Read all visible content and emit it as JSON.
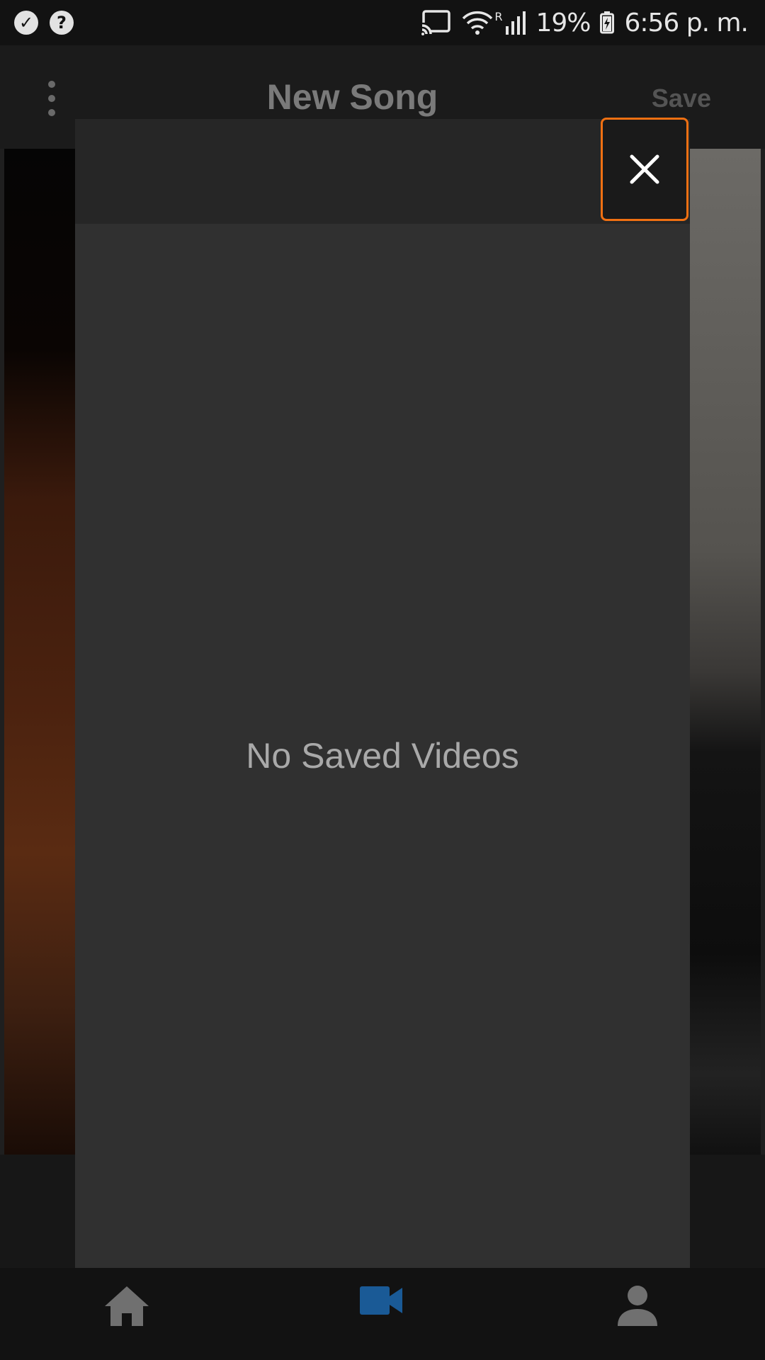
{
  "status_bar": {
    "battery": "19%",
    "time": "6:56 p. m.",
    "roaming": "R",
    "icons": [
      "check-circle-icon",
      "help-circle-icon",
      "cast-icon",
      "wifi-icon",
      "signal-icon",
      "battery-charging-icon"
    ]
  },
  "app_bar": {
    "title": "New Song",
    "save_label": "Save",
    "menu_icon": "more-vertical-icon"
  },
  "modal": {
    "empty_message": "No Saved Videos",
    "close_icon": "close-icon",
    "accent_color": "#f07012"
  },
  "bottom_nav": {
    "items": [
      {
        "name": "home",
        "icon": "home-icon"
      },
      {
        "name": "video",
        "icon": "video-camera-icon",
        "active": true
      },
      {
        "name": "profile",
        "icon": "person-icon"
      }
    ],
    "active_color": "#1a5a96",
    "inactive_color": "#707070"
  }
}
